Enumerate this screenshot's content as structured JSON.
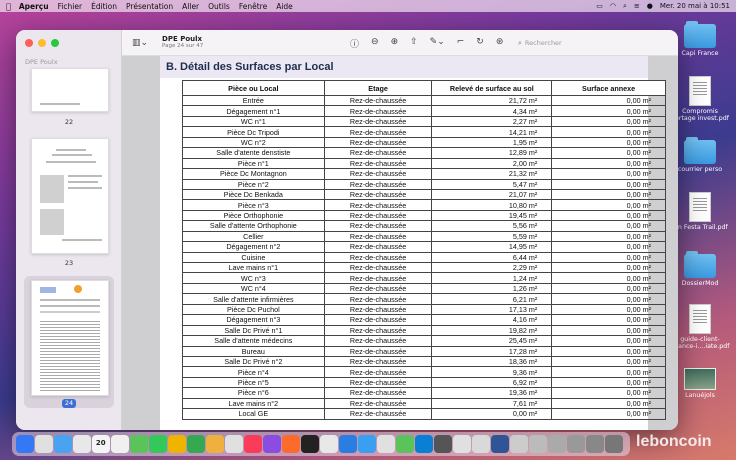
{
  "menubar": {
    "app": "Aperçu",
    "items": [
      "Fichier",
      "Édition",
      "Présentation",
      "Aller",
      "Outils",
      "Fenêtre",
      "Aide"
    ],
    "clock": "Mer. 20 mai à 10:51"
  },
  "sidebar": {
    "title": "DPE Poulx",
    "pages": [
      "22",
      "23",
      "24"
    ]
  },
  "toolbar": {
    "doc_title": "DPE Poulx",
    "page_info": "Page 24 sur 47",
    "search_placeholder": "Rechercher"
  },
  "document": {
    "section_title": "B.  Détail des Surfaces par Local",
    "columns": [
      "Pièce ou Local",
      "Etage",
      "Relevé de surface au sol",
      "Surface annexe"
    ],
    "rows": [
      [
        "Entrée",
        "Rez-de-chaussée",
        "21,72 m²",
        "0,00 m²"
      ],
      [
        "Dégagement n°1",
        "Rez-de-chaussée",
        "4,34 m²",
        "0,00 m²"
      ],
      [
        "WC n°1",
        "Rez-de-chaussée",
        "2,27 m²",
        "0,00 m²"
      ],
      [
        "Pièce Dc Tripodi",
        "Rez-de-chaussée",
        "14,21 m²",
        "0,00 m²"
      ],
      [
        "WC n°2",
        "Rez-de-chaussée",
        "1,95 m²",
        "0,00 m²"
      ],
      [
        "Salle d'atente denstiste",
        "Rez-de-chaussée",
        "12,89 m²",
        "0,00 m²"
      ],
      [
        "Pièce n°1",
        "Rez-de-chaussée",
        "2,00 m²",
        "0,00 m²"
      ],
      [
        "Pièce Dc Montagnon",
        "Rez-de-chaussée",
        "21,32 m²",
        "0,00 m²"
      ],
      [
        "Pièce n°2",
        "Rez-de-chaussée",
        "5,47 m²",
        "0,00 m²"
      ],
      [
        "Pièce Dc Benkada",
        "Rez-de-chaussée",
        "21,07 m²",
        "0,00 m²"
      ],
      [
        "Pièce n°3",
        "Rez-de-chaussée",
        "10,80 m²",
        "0,00 m²"
      ],
      [
        "Pièce Orthophonie",
        "Rez-de-chaussée",
        "19,45 m²",
        "0,00 m²"
      ],
      [
        "Salle d'attente Orthophonie",
        "Rez-de-chaussée",
        "5,56 m²",
        "0,00 m²"
      ],
      [
        "Cellier",
        "Rez-de-chaussée",
        "5,59 m²",
        "0,00 m²"
      ],
      [
        "Dégagement n°2",
        "Rez-de-chaussée",
        "14,95 m²",
        "0,00 m²"
      ],
      [
        "Cuisine",
        "Rez-de-chaussée",
        "6,44 m²",
        "0,00 m²"
      ],
      [
        "Lave mains n°1",
        "Rez-de-chaussée",
        "2,29 m²",
        "0,00 m²"
      ],
      [
        "WC n°3",
        "Rez-de-chaussée",
        "1,24 m²",
        "0,00 m²"
      ],
      [
        "WC n°4",
        "Rez-de-chaussée",
        "1,26 m²",
        "0,00 m²"
      ],
      [
        "Salle d'attente infirmières",
        "Rez-de-chaussée",
        "6,21 m²",
        "0,00 m²"
      ],
      [
        "Pièce Dc Puchol",
        "Rez-de-chaussée",
        "17,13 m²",
        "0,00 m²"
      ],
      [
        "Dégagement n°3",
        "Rez-de-chaussée",
        "4,16 m²",
        "0,00 m²"
      ],
      [
        "Salle Dc Privé n°1",
        "Rez-de-chaussée",
        "19,82 m²",
        "0,00 m²"
      ],
      [
        "Salle d'attente médecins",
        "Rez-de-chaussée",
        "25,45 m²",
        "0,00 m²"
      ],
      [
        "Bureau",
        "Rez-de-chaussée",
        "17,28 m²",
        "0,00 m²"
      ],
      [
        "Salle Dc Privé n°2",
        "Rez-de-chaussée",
        "18,36 m²",
        "0,00 m²"
      ],
      [
        "Pièce n°4",
        "Rez-de-chaussée",
        "9,36 m²",
        "0,00 m²"
      ],
      [
        "Pièce n°5",
        "Rez-de-chaussée",
        "6,92 m²",
        "0,00 m²"
      ],
      [
        "Pièce n°6",
        "Rez-de-chaussée",
        "19,36 m²",
        "0,00 m²"
      ],
      [
        "Lave mains n°2",
        "Rez-de-chaussée",
        "7,61 m²",
        "0,00 m²"
      ],
      [
        "Local GE",
        "Rez-de-chaussée",
        "0,00 m²",
        "0,00 m²"
      ]
    ]
  },
  "desktop": {
    "items": [
      {
        "label": "Capi France",
        "icon": "folder-icon"
      },
      {
        "label": "Compromis portage invest.pdf",
        "icon": "pdf-icon"
      },
      {
        "label": "courrier perso",
        "icon": "folder-icon"
      },
      {
        "label": "Ian Festa Trail.pdf",
        "icon": "pdf-icon"
      },
      {
        "label": "DossierMod",
        "icon": "folder-icon"
      },
      {
        "label": "guide-client-avance-i....iate.pdf",
        "icon": "pdf-icon"
      },
      {
        "label": "Lanuéjols",
        "icon": "image-icon"
      }
    ]
  },
  "dock": {
    "calendar_day": "20",
    "apps": [
      "#3478f6",
      "#e0e0e0",
      "#4aa3f0",
      "#e8e8e8",
      "#e04a3a",
      "#f0f0f0",
      "#5ac35a",
      "#34c759",
      "#f0b400",
      "#35a852",
      "#f0b040",
      "#e0e0e0",
      "#fa3c5a",
      "#8a4de0",
      "#fc6a2c",
      "#222222",
      "#e8e8e8",
      "#2a7de1",
      "#3a9ff0",
      "#e0e0e0",
      "#5ac35a",
      "#0b7fd4",
      "#555555",
      "#e0e0e0",
      "#d9d9d9",
      "#2f5597",
      "#cccccc",
      "#bbbbbb",
      "#aaaaaa",
      "#999999",
      "#888888",
      "#777777"
    ],
    "watermark": "leboncoin"
  }
}
